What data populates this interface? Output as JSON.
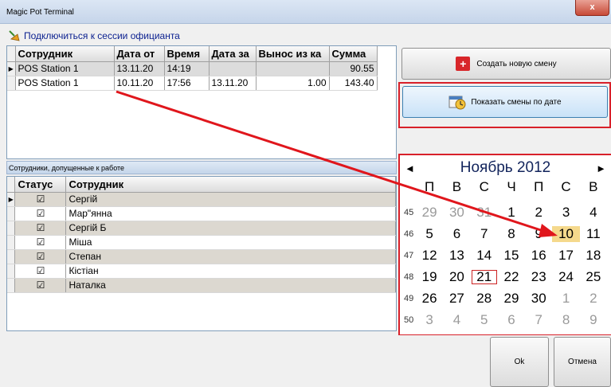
{
  "window": {
    "title": "Magic Pot Terminal",
    "close_label": "x"
  },
  "session_link": "Подключиться к сессии официанта",
  "shifts_grid": {
    "headers": [
      "Сотрудник",
      "Дата от",
      "Время",
      "Дата за",
      "Вынос из ка",
      "Сумма"
    ],
    "rows": [
      {
        "employee": "POS Station 1",
        "date_open": "13.11.20",
        "time": "14:19",
        "date_close": "",
        "withdrawal": "",
        "sum": "90.55"
      },
      {
        "employee": "POS Station 1",
        "date_open": "10.11.20",
        "time": "17:56",
        "date_close": "13.11.20",
        "withdrawal": "1.00",
        "sum": "143.40"
      }
    ]
  },
  "staff_panel": {
    "title": "Сотрудники, допущенные к работе",
    "headers": [
      "Статус",
      "Сотрудник"
    ],
    "rows": [
      {
        "status": "☑",
        "name": "Сергій"
      },
      {
        "status": "☑",
        "name": "Мар\"янна"
      },
      {
        "status": "☑",
        "name": "Сергій Б"
      },
      {
        "status": "☑",
        "name": "Міша"
      },
      {
        "status": "☑",
        "name": "Степан"
      },
      {
        "status": "☑",
        "name": "Кістіан"
      },
      {
        "status": "☑",
        "name": "Наталка"
      }
    ]
  },
  "buttons": {
    "create_shift": "Создать новую смену",
    "show_by_date": "Показать смены по дате",
    "ok": "Ok",
    "cancel": "Отмена"
  },
  "calendar": {
    "month_title": "Ноябрь 2012",
    "prev": "◄",
    "next": "►",
    "weekdays": [
      "П",
      "В",
      "С",
      "Ч",
      "П",
      "С",
      "В"
    ],
    "weeks": [
      {
        "num": "45",
        "days": [
          "29",
          "30",
          "31",
          "1",
          "2",
          "3",
          "4"
        ]
      },
      {
        "num": "46",
        "days": [
          "5",
          "6",
          "7",
          "8",
          "9",
          "10",
          "11"
        ]
      },
      {
        "num": "47",
        "days": [
          "12",
          "13",
          "14",
          "15",
          "16",
          "17",
          "18"
        ]
      },
      {
        "num": "48",
        "days": [
          "19",
          "20",
          "21",
          "22",
          "23",
          "24",
          "25"
        ]
      },
      {
        "num": "49",
        "days": [
          "26",
          "27",
          "28",
          "29",
          "30",
          "1",
          "2"
        ]
      },
      {
        "num": "50",
        "days": [
          "3",
          "4",
          "5",
          "6",
          "7",
          "8",
          "9"
        ]
      }
    ]
  },
  "colors": {
    "highlight": "#d8202a",
    "today": "#f5d98c",
    "arrow": "#e0161c"
  }
}
